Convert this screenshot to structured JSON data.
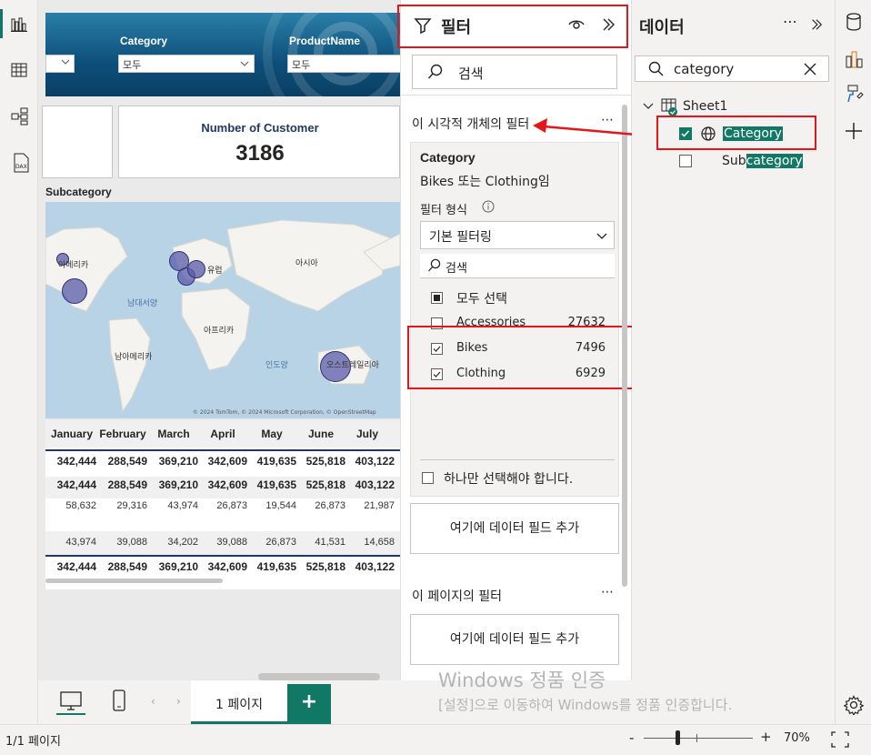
{
  "canvas": {
    "slicers": [
      {
        "label": "Category",
        "value": "모두"
      },
      {
        "label": "ProductName",
        "value": "모두"
      }
    ],
    "kpi": {
      "title": "Number of Customer",
      "value": "3186"
    },
    "map": {
      "title": "Subcategory",
      "labels": {
        "north_america": "아메리카",
        "europe": "유럽",
        "asia": "아시아",
        "atlantic": "남대서양",
        "africa": "아프리카",
        "south_america": "남아메리카",
        "indian_ocean": "인도양",
        "australia": "오스트레일리아"
      },
      "attribution": "© 2024 TomTom, © 2024 Microsoft Corporation, © OpenStreetMap"
    },
    "table": {
      "columns": [
        "January",
        "February",
        "March",
        "April",
        "May",
        "June",
        "July"
      ],
      "rows": [
        [
          "342,444",
          "288,549",
          "369,210",
          "342,609",
          "419,635",
          "525,818",
          "403,122"
        ],
        [
          "342,444",
          "288,549",
          "369,210",
          "342,609",
          "419,635",
          "525,818",
          "403,122"
        ],
        [
          "58,632",
          "29,316",
          "43,974",
          "26,873",
          "19,544",
          "26,873",
          "21,987"
        ],
        [
          "43,974",
          "39,088",
          "34,202",
          "39,088",
          "26,873",
          "41,531",
          "14,658"
        ],
        [
          "342,444",
          "288,549",
          "369,210",
          "342,609",
          "419,635",
          "525,818",
          "403,122"
        ]
      ]
    }
  },
  "filter_pane": {
    "title": "필터",
    "search_placeholder": "검색",
    "visual_section": "이 시각적 개체의 필터",
    "card": {
      "field": "Category",
      "summary": "Bikes 또는 Clothing임",
      "type_label": "필터 형식",
      "type_value": "기본 필터링",
      "search": "검색",
      "select_all": "모두 선택",
      "items": [
        {
          "label": "Accessories",
          "count": "27632",
          "checked": false
        },
        {
          "label": "Bikes",
          "count": "7496",
          "checked": true
        },
        {
          "label": "Clothing",
          "count": "6929",
          "checked": true
        }
      ],
      "single_select": "하나만 선택해야 합니다."
    },
    "add_field": "여기에 데이터 필드 추가",
    "page_section": "이 페이지의 필터",
    "add_field_page": "여기에 데이터 필드 추가"
  },
  "data_pane": {
    "title": "데이터",
    "search_value": "category",
    "table_name": "Sheet1",
    "fields": [
      {
        "label": "Category",
        "checked": true
      },
      {
        "label_prefix": "Sub",
        "label_match": "category",
        "checked": false
      }
    ]
  },
  "bottom": {
    "page_tab": "1 페이지",
    "add_page": "+",
    "status": "1/1 페이지",
    "zoom": "70%",
    "zoom_minus": "-",
    "zoom_plus": "+"
  },
  "watermark": {
    "line1": "Windows 정품 인증",
    "line2": "[설정]으로 이동하여 Windows를 정품 인증합니다."
  },
  "colors": {
    "accent": "#117865",
    "highlight": "#117865",
    "annotation": "#e5161a"
  }
}
